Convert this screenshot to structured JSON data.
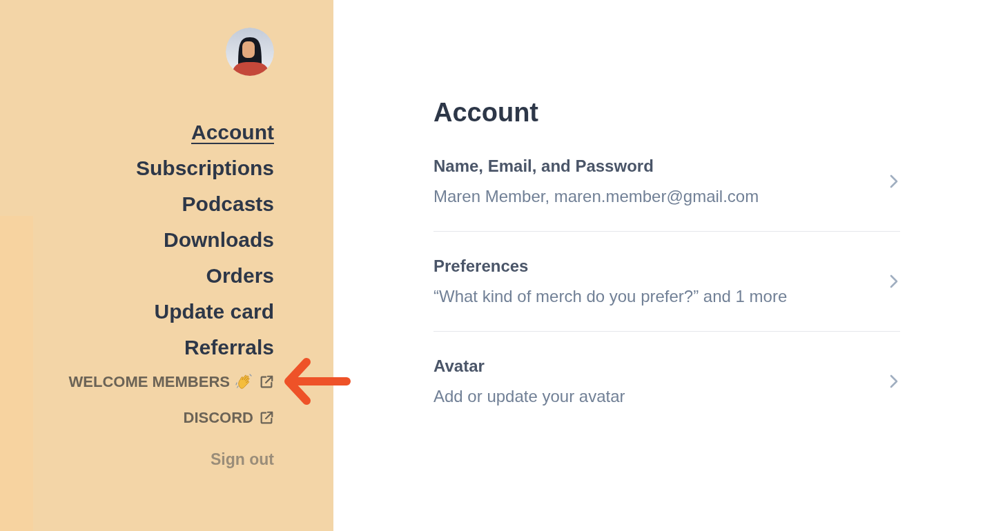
{
  "sidebar": {
    "nav": [
      {
        "label": "Account",
        "selected": true
      },
      {
        "label": "Subscriptions",
        "selected": false
      },
      {
        "label": "Podcasts",
        "selected": false
      },
      {
        "label": "Downloads",
        "selected": false
      },
      {
        "label": "Orders",
        "selected": false
      },
      {
        "label": "Update card",
        "selected": false
      },
      {
        "label": "Referrals",
        "selected": false
      }
    ],
    "external_links": [
      {
        "label": "WELCOME MEMBERS",
        "kind": "wave"
      },
      {
        "label": "DISCORD",
        "kind": "plain"
      }
    ],
    "sign_out": "Sign out"
  },
  "main": {
    "title": "Account",
    "rows": [
      {
        "title": "Name, Email, and Password",
        "detail": "Maren Member, maren.member@gmail.com"
      },
      {
        "title": "Preferences",
        "detail": "“What kind of merch do you prefer?” and 1 more"
      },
      {
        "title": "Avatar",
        "detail": "Add or update your avatar"
      }
    ]
  }
}
